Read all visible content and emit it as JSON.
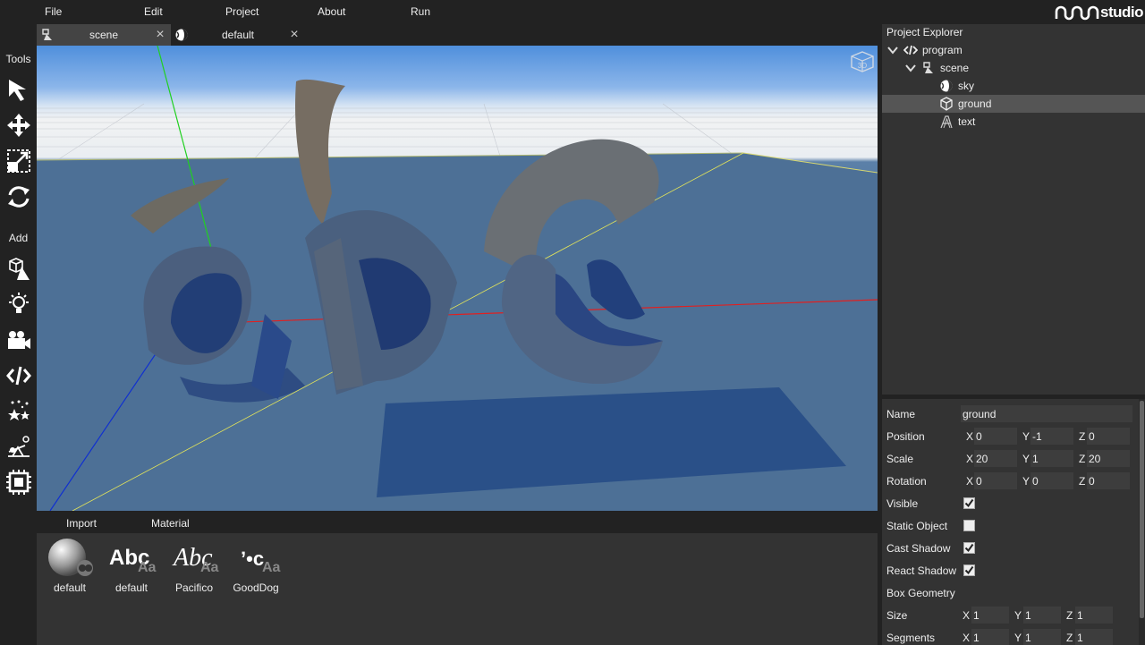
{
  "menu": {
    "file": "File",
    "edit": "Edit",
    "project": "Project",
    "about": "About",
    "run": "Run",
    "logo_text": "studio"
  },
  "tabs": [
    {
      "label": "scene",
      "icon": "scene-icon",
      "close": "×"
    },
    {
      "label": "default",
      "icon": "sky-icon",
      "close": "×"
    }
  ],
  "toolbar": {
    "tools_label": "Tools",
    "add_label": "Add",
    "tools": [
      "select-arrow-icon",
      "move-icon",
      "scale-icon",
      "rotate-icon"
    ],
    "add": [
      "add-shapes-icon",
      "add-light-icon",
      "add-camera-icon",
      "add-script-icon",
      "add-particles-icon",
      "add-physics-icon",
      "add-chip-icon"
    ]
  },
  "bottom_tabs": {
    "import": "Import",
    "material": "Material"
  },
  "assets": [
    {
      "label": "default",
      "type": "material-sphere"
    },
    {
      "label": "default",
      "type": "font",
      "sample": "Abc",
      "badge": "Aa"
    },
    {
      "label": "Pacifico",
      "type": "font",
      "sample": "Abc",
      "badge": "Aa"
    },
    {
      "label": "GoodDog",
      "type": "font",
      "sample": "ʼ•c",
      "badge": "Aa"
    }
  ],
  "explorer": {
    "title": "Project Explorer",
    "items": [
      {
        "label": "program",
        "icon": "code-icon"
      },
      {
        "label": "scene",
        "icon": "scene-icon"
      },
      {
        "label": "sky",
        "icon": "sky-icon"
      },
      {
        "label": "ground",
        "icon": "cube-icon"
      },
      {
        "label": "text",
        "icon": "text-icon"
      }
    ]
  },
  "properties": {
    "name_label": "Name",
    "name_value": "ground",
    "position_label": "Position",
    "position": {
      "x": "0",
      "y": "-1",
      "z": "0"
    },
    "scale_label": "Scale",
    "scale": {
      "x": "20",
      "y": "1",
      "z": "20"
    },
    "rotation_label": "Rotation",
    "rotation": {
      "x": "0",
      "y": "0",
      "z": "0"
    },
    "visible_label": "Visible",
    "visible": true,
    "static_label": "Static Object",
    "static": false,
    "cast_shadow_label": "Cast Shadow",
    "cast_shadow": true,
    "react_shadow_label": "React Shadow",
    "react_shadow": true,
    "geometry_label": "Box Geometry",
    "size_label": "Size",
    "size": {
      "x": "1",
      "y": "1",
      "z": "1"
    },
    "segments_label": "Segments",
    "segments": {
      "x": "1",
      "y": "1",
      "z": "1"
    },
    "axis": {
      "x": "X",
      "y": "Y",
      "z": "Z"
    }
  },
  "viewport": {
    "view_cube_label": "3D"
  },
  "colors": {
    "panel": "#333333",
    "background": "#222222",
    "selected_row": "#555555",
    "axis_x": "#e02020",
    "axis_y": "#20d020",
    "axis_z": "#1030d0"
  }
}
